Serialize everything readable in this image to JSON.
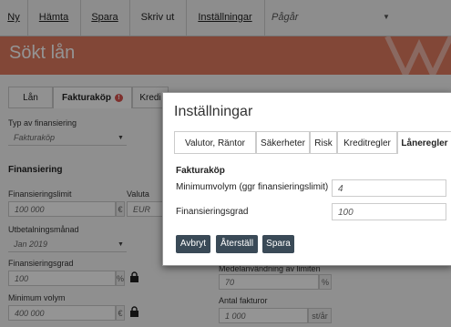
{
  "menu": {
    "items": [
      "Ny",
      "Hämta",
      "Spara",
      "Skriv ut",
      "Inställningar"
    ],
    "status": "Pågår"
  },
  "banner": {
    "title": "Sökt lån"
  },
  "tabs": [
    "Lån",
    "Fakturaköp",
    "Kredi"
  ],
  "tab_badge": "!",
  "form": {
    "financing_type_label": "Typ av finansiering",
    "financing_type_value": "Fakturaköp",
    "section_financing": "Finansiering",
    "limit_label": "Finansieringslimit",
    "limit_value": "100 000",
    "limit_unit": "€",
    "currency_label": "Valuta",
    "currency_value": "EUR",
    "payout_month_label": "Utbetalningsmånad",
    "payout_month_value": "Jan 2019",
    "degree_label": "Finansieringsgrad",
    "degree_value": "100",
    "degree_unit": "%",
    "min_volume_label": "Minimum volym",
    "min_volume_value": "400 000",
    "min_volume_unit": "€",
    "avg_usage_label": "Medelanvändning av limiten",
    "avg_usage_value": "70",
    "avg_usage_unit": "%",
    "invoice_count_label": "Antal fakturor",
    "invoice_count_value": "1 000",
    "invoice_count_unit": "st/år"
  },
  "modal": {
    "title": "Inställningar",
    "tabs": [
      "Valutor, Räntor",
      "Säkerheter",
      "Risk",
      "Kreditregler",
      "Låneregler"
    ],
    "section": "Fakturaköp",
    "min_volume_label": "Minimumvolym (ggr finansieringslimit)",
    "min_volume_value": "4",
    "degree_label": "Finansieringsgrad",
    "degree_value": "100",
    "buttons": {
      "cancel": "Avbryt",
      "reset": "Återställ",
      "save": "Spara"
    }
  }
}
